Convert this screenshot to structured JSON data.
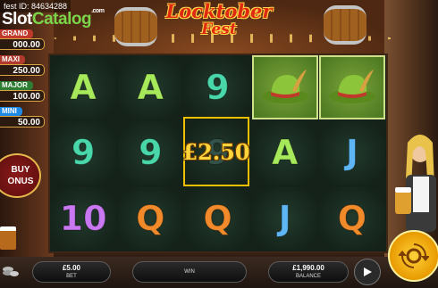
{
  "watermark": "fest ID: 84634288",
  "site_logo": {
    "part1": "Slot",
    "part2": "Catalog",
    "suffix": ".com"
  },
  "game_logo": {
    "line1": "Locktober",
    "line2": "Fest"
  },
  "jackpots": [
    {
      "label": "GRAND",
      "value": "000.00"
    },
    {
      "label": "MAXI",
      "value": "250.00"
    },
    {
      "label": "MAJOR",
      "value": "100.00"
    },
    {
      "label": "MINI",
      "value": "50.00"
    }
  ],
  "buy_bonus": {
    "line1": "BUY",
    "line2": "ONUS"
  },
  "reels": [
    [
      {
        "sym": "A",
        "color": "green"
      },
      {
        "sym": "9",
        "color": "teal"
      },
      {
        "sym": "10",
        "color": "purple"
      }
    ],
    [
      {
        "sym": "A",
        "color": "green"
      },
      {
        "sym": "9",
        "color": "teal"
      },
      {
        "sym": "Q",
        "color": "orange"
      }
    ],
    [
      {
        "sym": "9",
        "color": "teal"
      },
      {
        "sym": "9",
        "color": "dim"
      },
      {
        "sym": "Q",
        "color": "orange"
      }
    ],
    [
      {
        "sym": "hat-icon",
        "color": "win"
      },
      {
        "sym": "A",
        "color": "green"
      },
      {
        "sym": "J",
        "color": "blue"
      }
    ],
    [
      {
        "sym": "hat-icon",
        "color": "win"
      },
      {
        "sym": "J",
        "color": "blue"
      },
      {
        "sym": "Q",
        "color": "orange"
      }
    ]
  ],
  "win_amount": "£2.50",
  "bottom_bar": {
    "bet_value": "£5.00",
    "bet_label": "BET",
    "win_value": "",
    "win_label": "WIN",
    "balance_value": "£1,990.00",
    "balance_label": "BALANCE"
  },
  "colors": {
    "green": "#a6e95a",
    "teal": "#49d7a9",
    "orange": "#f08a2a",
    "purple": "#c878f0",
    "blue": "#5fb6f5",
    "dim": "#33524a",
    "win_highlight": "#7ca43a"
  }
}
